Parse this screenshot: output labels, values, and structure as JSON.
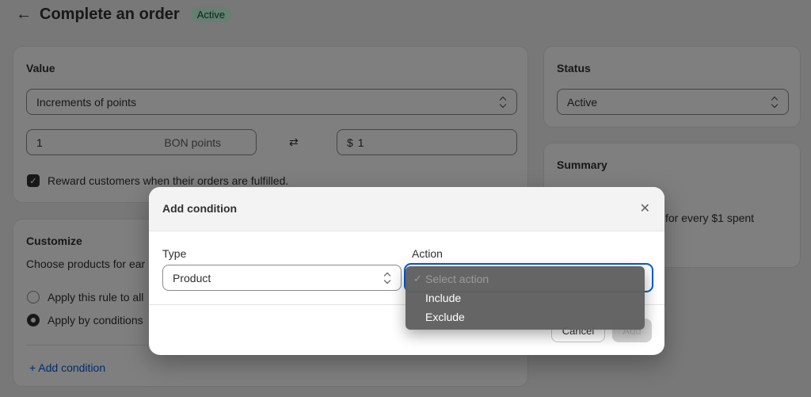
{
  "header": {
    "back_icon": "arrow-left-icon",
    "title": "Complete an order",
    "status_badge": "Active"
  },
  "value_card": {
    "title": "Value",
    "method_select": "Increments of points",
    "points_input": "1",
    "points_suffix": "BON points",
    "exchange_icon": "arrows-exchange-icon",
    "amount_prefix": "$",
    "amount_input": "1",
    "fulfilled_checkbox_checked": true,
    "fulfilled_checkbox_label": "Reward customers when their orders are fulfilled."
  },
  "customize_card": {
    "title": "Customize",
    "description": "Choose products for ear",
    "radio_all_label": "Apply this rule to all",
    "radio_conditions_label": "Apply by conditions",
    "selected_radio": "conditions",
    "add_condition_label": "+ Add condition"
  },
  "status_card": {
    "title": "Status",
    "status_select": "Active"
  },
  "summary_card": {
    "title": "Summary",
    "text": "for every $1 spent"
  },
  "modal": {
    "title": "Add condition",
    "close_icon": "close-icon",
    "type_label": "Type",
    "type_value": "Product",
    "action_label": "Action",
    "action_options": [
      {
        "label": "Select action",
        "selected": true,
        "disabled": true
      },
      {
        "label": "Include",
        "selected": false,
        "disabled": false
      },
      {
        "label": "Exclude",
        "selected": false,
        "disabled": false
      }
    ],
    "cancel_label": "Cancel",
    "add_label": "Add"
  },
  "colors": {
    "badge_bg": "#cdfee1",
    "link": "#005bd3",
    "focus": "#005bd3"
  }
}
